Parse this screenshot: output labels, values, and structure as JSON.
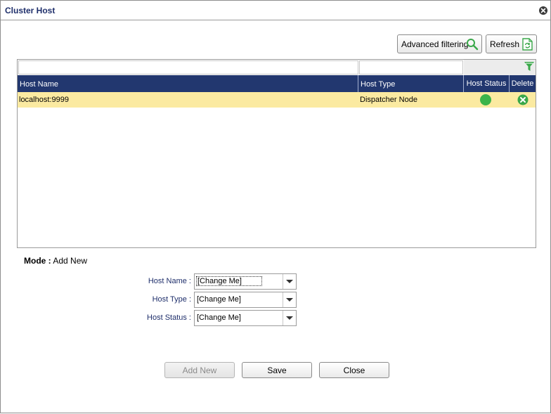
{
  "window": {
    "title": "Cluster Host",
    "close_icon": "close-icon"
  },
  "toolbar": {
    "advanced_filtering_label": "Advanced filtering",
    "refresh_label": "Refresh"
  },
  "grid": {
    "columns": [
      "Host Name",
      "Host Type",
      "Host Status",
      "Delete"
    ],
    "rows": [
      {
        "host_name": "localhost:9999",
        "host_type": "Dispatcher Node",
        "status_color": "#3cb44a"
      }
    ],
    "header_color": "#22376f",
    "selected_row_color": "#fbeaa1"
  },
  "form": {
    "mode_label": "Mode :",
    "mode_value": "Add New",
    "fields": [
      {
        "label": "Host Name :",
        "value": "[Change Me]"
      },
      {
        "label": "Host Type :",
        "value": "[Change Me]"
      },
      {
        "label": "Host Status :",
        "value": "[Change Me]"
      }
    ]
  },
  "buttons": {
    "add_new": "Add New",
    "save": "Save",
    "close": "Close"
  }
}
